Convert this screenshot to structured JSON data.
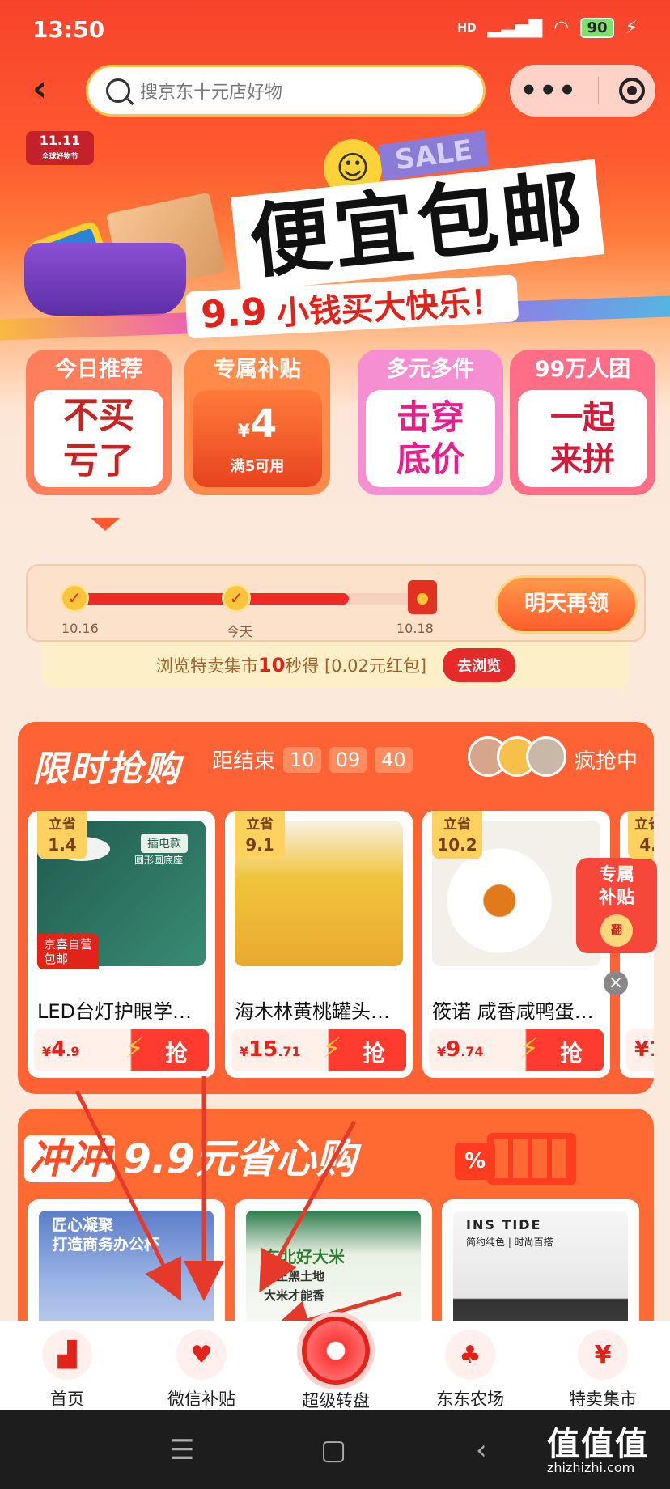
{
  "status_bar": {
    "time": "13:50",
    "network": "HD",
    "battery": "90"
  },
  "header": {
    "search_placeholder": "搜京东十元店好物"
  },
  "banner": {
    "badge": "11.11",
    "badge_sub": "全球好物节",
    "sale": "SALE",
    "title": "便宜包邮",
    "price": "9.9",
    "slogan": "小钱买大快乐！"
  },
  "cards": [
    {
      "head": "今日推荐",
      "line1": "不买",
      "line2": "亏了"
    },
    {
      "head": "专属补贴",
      "currency": "¥",
      "amount": "4",
      "condition": "满5可用"
    },
    {
      "head": "多元多件",
      "line1": "击穿",
      "line2": "底价"
    },
    {
      "head": "99万人团",
      "line1": "一起",
      "line2": "来拼"
    }
  ],
  "checkin": {
    "progress": 0.78,
    "days": [
      "10.16",
      "今天",
      "10.18"
    ],
    "button": "明天再领",
    "browse_prefix": "浏览特卖集市",
    "browse_seconds": "10",
    "browse_suffix": "秒得 [0.02元红包]",
    "browse_button": "去浏览"
  },
  "flash_sale": {
    "title": "限时抢购",
    "ends_label": "距结束",
    "hours": "10",
    "minutes": "09",
    "seconds": "40",
    "status": "疯抢中",
    "products": [
      {
        "save_label": "立省",
        "save": "1.4",
        "name": "LED台灯护眼学…",
        "price_int": "4",
        "price_dec": ".9",
        "grab": "抢",
        "tag_line1": "京喜自营",
        "tag_line2": "包邮",
        "img_text": "插电款",
        "img_sub": "圆形圆底座"
      },
      {
        "save_label": "立省",
        "save": "9.1",
        "name": "海木林黄桃罐头…",
        "price_int": "15",
        "price_dec": ".71",
        "grab": "抢"
      },
      {
        "save_label": "立省",
        "save": "10.2",
        "name": "筱诺 咸香咸鸭蛋…",
        "price_int": "9",
        "price_dec": ".74",
        "grab": "抢"
      }
    ],
    "partial_save_label": "立省",
    "partial_save": "4.",
    "partial_price": "¥1"
  },
  "subsidy_float": {
    "line1": "专属",
    "line2": "补贴",
    "coin": "翻"
  },
  "section99": {
    "badge": "冲冲",
    "title": "9.9元省心购",
    "cart_tag": "%",
    "tiles": [
      {
        "line1": "匠心凝聚",
        "line2": "打造商务办公杯"
      },
      {
        "line1": "东北好大米",
        "line2": "纯正黑土地",
        "line3": "大米才能香"
      },
      {
        "line1": "INS TIDE",
        "line2": "简约纯色 | 时尚百搭"
      }
    ]
  },
  "tabbar": [
    {
      "label": "首页",
      "icon": "home-icon"
    },
    {
      "label": "微信补贴",
      "icon": "heart-pulse-icon"
    },
    {
      "label": "超级转盘",
      "icon": "wheel-icon"
    },
    {
      "label": "东东农场",
      "icon": "tree-icon"
    },
    {
      "label": "特卖集市",
      "icon": "coupon-icon"
    }
  ],
  "watermark": {
    "logo": "值值值",
    "url": "zhizhizhi.com"
  },
  "colors": {
    "primary": "#e2231a",
    "accent": "#ff6335",
    "gold": "#ffc53a"
  }
}
